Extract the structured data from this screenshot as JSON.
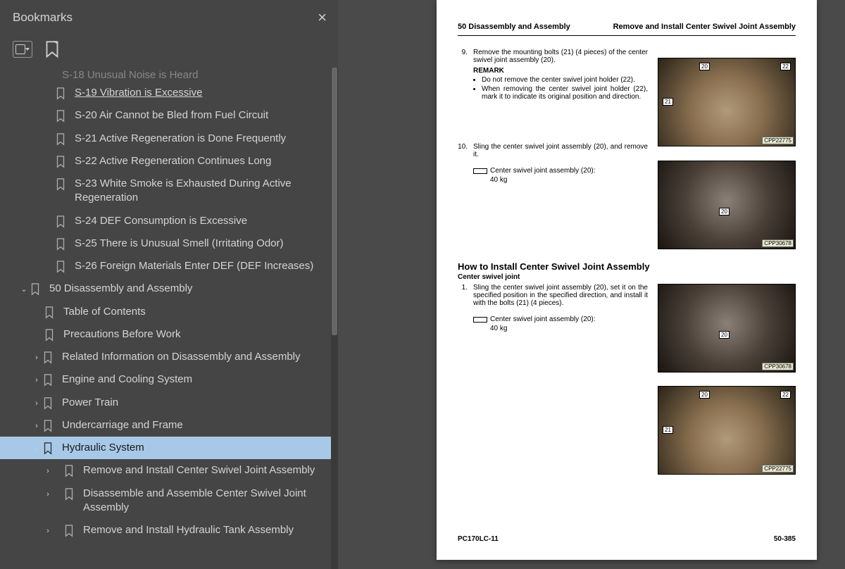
{
  "panel": {
    "title": "Bookmarks"
  },
  "tree": {
    "cutoff": "S-18 Unusual Noise is Heard",
    "items": [
      {
        "label": "S-19 Vibration is Excessive",
        "indent": "ind1",
        "chev": "",
        "under": true
      },
      {
        "label": "S-20 Air Cannot be Bled from Fuel Circuit",
        "indent": "ind1",
        "chev": ""
      },
      {
        "label": "S-21 Active Regeneration is Done Frequently",
        "indent": "ind1",
        "chev": ""
      },
      {
        "label": "S-22 Active Regeneration Continues Long",
        "indent": "ind1",
        "chev": ""
      },
      {
        "label": "S-23 White Smoke is Exhausted During Active Regeneration",
        "indent": "ind1",
        "chev": ""
      },
      {
        "label": "S-24 DEF Consumption is Excessive",
        "indent": "ind1",
        "chev": ""
      },
      {
        "label": "S-25 There is Unusual Smell (Irritating Odor)",
        "indent": "ind1",
        "chev": ""
      },
      {
        "label": "S-26 Foreign Materials Enter DEF (DEF Increases)",
        "indent": "ind1",
        "chev": ""
      },
      {
        "label": "50 Disassembly and Assembly",
        "indent": "ind1b",
        "chev": "⌄"
      },
      {
        "label": "Table of Contents",
        "indent": "ind2",
        "chev": ""
      },
      {
        "label": "Precautions Before Work",
        "indent": "ind2",
        "chev": ""
      },
      {
        "label": "Related Information on Disassembly and Assembly",
        "indent": "ind3",
        "chev": "›"
      },
      {
        "label": "Engine and Cooling System",
        "indent": "ind3",
        "chev": "›"
      },
      {
        "label": "Power Train",
        "indent": "ind3",
        "chev": "›"
      },
      {
        "label": "Undercarriage and Frame",
        "indent": "ind3",
        "chev": "›"
      },
      {
        "label": "Hydraulic System",
        "indent": "ind3",
        "chev": "⌄",
        "sel": true
      },
      {
        "label": "Remove and Install Center Swivel Joint Assembly",
        "indent": "ind4",
        "chev": "›"
      },
      {
        "label": "Disassemble and Assemble Center Swivel Joint Assembly",
        "indent": "ind4",
        "chev": "›"
      },
      {
        "label": "Remove and Install Hydraulic Tank Assembly",
        "indent": "ind4",
        "chev": "›"
      }
    ]
  },
  "doc": {
    "hdr_left": "50 Disassembly and Assembly",
    "hdr_right": "Remove and Install Center Swivel Joint Assembly",
    "step9_num": "9.",
    "step9_txt": "Remove the mounting bolts (21) (4 pieces) of the center swivel joint assembly (20).",
    "remark": "REMARK",
    "b1": "Do not remove the center swivel joint holder (22).",
    "b2": "When removing the center swivel joint holder (22), mark it to indicate its original position and direction.",
    "step10_num": "10.",
    "step10_txt": "Sling the center swivel joint assembly (20), and remove it.",
    "assy_label": "Center swivel joint assembly (20):",
    "assy_val": "40 kg",
    "h2": "How to Install Center Swivel Joint Assembly",
    "h3": "Center swivel joint",
    "inst1_num": "1.",
    "inst1_txt": "Sling the center swivel joint assembly (20), set it on the specified position in the specified direction, and install it with the bolts (21) (4 pieces).",
    "fig1_id": "CPP22775",
    "fig2_id": "CPP30678",
    "fig3_id": "CPP30678",
    "fig4_id": "CPP22775",
    "c20": "20",
    "c21": "21",
    "c22": "22",
    "ftr_left": "PC170LC-11",
    "ftr_right": "50-385"
  }
}
